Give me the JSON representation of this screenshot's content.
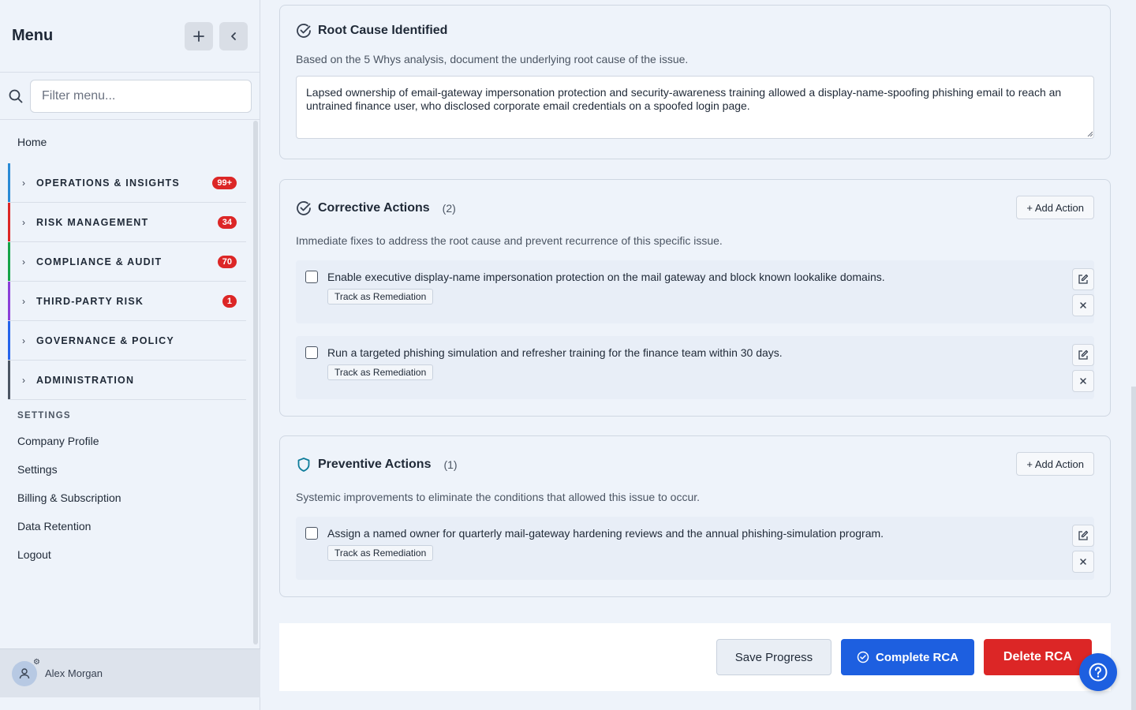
{
  "sidebar": {
    "title": "Menu",
    "add_icon": "plus-icon",
    "collapse_icon": "chevron-left-icon",
    "filter_placeholder": "Filter menu...",
    "home_label": "Home",
    "groups": [
      {
        "label": "OPERATIONS & INSIGHTS",
        "badge": "99+",
        "color": "#2b8bd6"
      },
      {
        "label": "RISK MANAGEMENT",
        "badge": "34",
        "color": "#dc2626"
      },
      {
        "label": "COMPLIANCE & AUDIT",
        "badge": "70",
        "color": "#16a34a"
      },
      {
        "label": "THIRD-PARTY RISK",
        "badge": "1",
        "color": "#8b3fd9"
      },
      {
        "label": "GOVERNANCE & POLICY",
        "badge": "",
        "color": "#2563eb"
      },
      {
        "label": "ADMINISTRATION",
        "badge": "",
        "color": "#4b5563"
      }
    ],
    "settings_heading": "SETTINGS",
    "settings_links": [
      "Company Profile",
      "Settings",
      "Billing & Subscription",
      "Data Retention",
      "Logout"
    ],
    "user_name": "Alex Morgan"
  },
  "root_cause": {
    "title": "Root Cause Identified",
    "description": "Based on the 5 Whys analysis, document the underlying root cause of the issue.",
    "value": "Lapsed ownership of email-gateway impersonation protection and security-awareness training allowed a display-name-spoofing phishing email to reach an untrained finance user, who disclosed corporate email credentials on a spoofed login page."
  },
  "corrective": {
    "title": "Corrective Actions",
    "count": "(2)",
    "add_label": "+ Add Action",
    "description": "Immediate fixes to address the root cause and prevent recurrence of this specific issue.",
    "items": [
      {
        "text": "Enable executive display-name impersonation protection on the mail gateway and block known lookalike domains.",
        "track_label": "Track as Remediation"
      },
      {
        "text": "Run a targeted phishing simulation and refresher training for the finance team within 30 days.",
        "track_label": "Track as Remediation"
      }
    ]
  },
  "preventive": {
    "title": "Preventive Actions",
    "count": "(1)",
    "add_label": "+ Add Action",
    "description": "Systemic improvements to eliminate the conditions that allowed this issue to occur.",
    "items": [
      {
        "text": "Assign a named owner for quarterly mail-gateway hardening reviews and the annual phishing-simulation program.",
        "track_label": "Track as Remediation"
      }
    ]
  },
  "footer": {
    "save_label": "Save Progress",
    "complete_label": "Complete RCA",
    "delete_label": "Delete RCA"
  },
  "colors": {
    "primary": "#1d5fe0",
    "danger": "#dc2626",
    "accent_teal": "#0e7c9a"
  }
}
